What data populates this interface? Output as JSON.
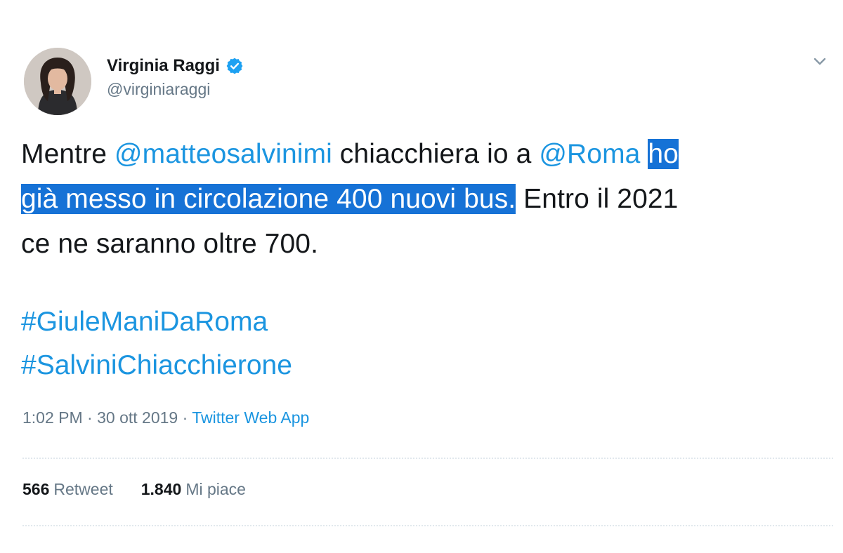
{
  "author": {
    "display_name": "Virginia Raggi",
    "handle": "@virginiaraggi",
    "verified": true,
    "avatar_icon": "profile-photo"
  },
  "tweet": {
    "segments": {
      "s1": "Mentre ",
      "s2": "@matteosalvinimi",
      "s3": " chiacchiera io a ",
      "s4": "@Roma",
      "s5": " ",
      "s6": "ho",
      "s7": "già messo in circolazione 400 nuovi bus.",
      "s8": " Entro il 2021",
      "s9": "ce ne saranno oltre 700."
    },
    "hashtags": [
      "#GiuleManiDaRoma",
      "#SalviniChiacchierone"
    ],
    "selected_text": "ho già messo in circolazione 400 nuovi bus."
  },
  "meta": {
    "time": "1:02 PM · 30 ott 2019 · ",
    "source": "Twitter Web App"
  },
  "stats": {
    "retweet_count": "566",
    "retweet_label": "Retweet",
    "like_count": "1.840",
    "like_label": "Mi piace"
  },
  "colors": {
    "link": "#1b95e0",
    "selection": "#1672d6",
    "verified": "#1da1f2",
    "muted": "#657786"
  }
}
